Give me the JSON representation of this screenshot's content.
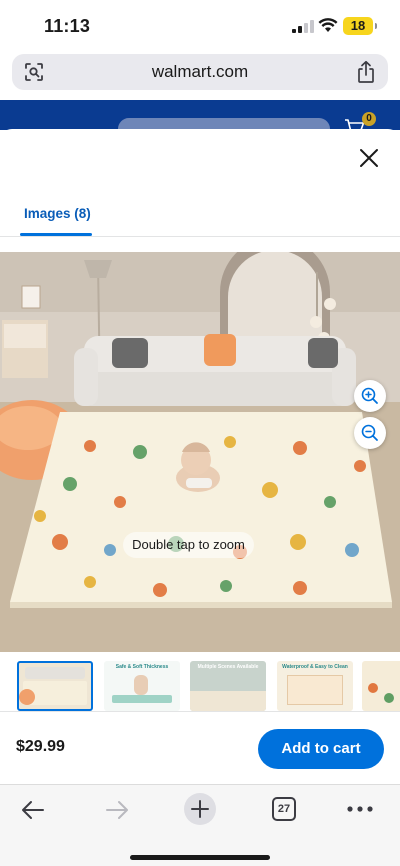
{
  "status_bar": {
    "time": "11:13",
    "battery": "18"
  },
  "browser": {
    "url": "walmart.com",
    "tab_count": "27"
  },
  "background_page": {
    "cart_count": "0"
  },
  "modal": {
    "tab_label": "Images (8)",
    "zoom_tooltip": "Double tap to zoom",
    "thumbnails": [
      {
        "caption": ""
      },
      {
        "caption": "Safe & Soft Thickness"
      },
      {
        "caption": "Multiple Scenes Available"
      },
      {
        "caption": "Waterproof & Easy to Clean"
      },
      {
        "caption": ""
      }
    ],
    "price": "$29.99",
    "add_to_cart_label": "Add to cart"
  },
  "icons": {
    "lens": "visual-search-icon",
    "share": "share-icon",
    "close": "close-icon",
    "zoom_in": "zoom-in-icon",
    "zoom_out": "zoom-out-icon",
    "back": "back-arrow-icon",
    "forward": "forward-arrow-icon",
    "new_tab": "plus-icon",
    "more": "ellipsis-icon",
    "cart": "cart-icon"
  },
  "colors": {
    "walmart_blue": "#0071dc",
    "header_blue": "#0a3b91",
    "tab_text": "#0a5db8",
    "battery": "#f7d51d"
  }
}
